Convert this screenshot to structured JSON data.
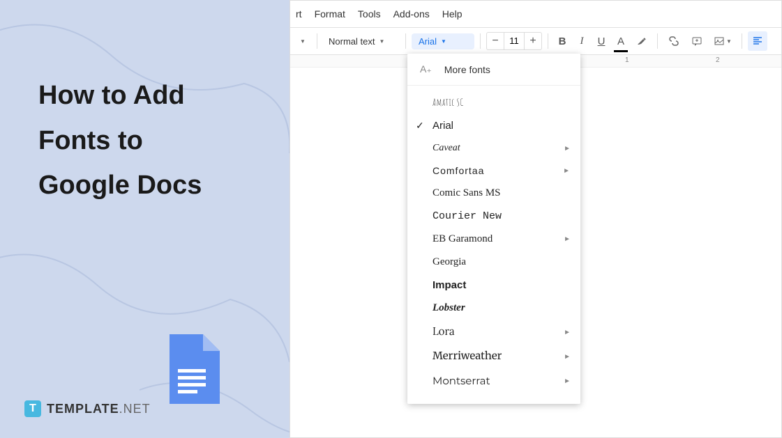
{
  "title_line1": "How to Add",
  "title_line2": "Fonts to",
  "title_line3": "Google Docs",
  "brand": {
    "logo_letter": "T",
    "name": "TEMPLATE",
    "suffix": ".NET"
  },
  "menubar": {
    "insert_truncated": "rt",
    "format": "Format",
    "tools": "Tools",
    "addons": "Add-ons",
    "help": "Help"
  },
  "toolbar": {
    "style_label": "Normal text",
    "font_label": "Arial",
    "font_size": "11",
    "bold": "B",
    "italic": "I",
    "underline": "U",
    "text_color": "A"
  },
  "ruler": {
    "mark1": "1",
    "mark2": "2"
  },
  "font_menu": {
    "more_fonts": "More fonts",
    "items": [
      {
        "label": "Amatic SC",
        "cls": "f-amatic",
        "has_sub": false,
        "checked": false
      },
      {
        "label": "Arial",
        "cls": "f-arial",
        "has_sub": false,
        "checked": true
      },
      {
        "label": "Caveat",
        "cls": "f-caveat",
        "has_sub": true,
        "checked": false
      },
      {
        "label": "Comfortaa",
        "cls": "f-comfortaa",
        "has_sub": true,
        "checked": false
      },
      {
        "label": "Comic Sans MS",
        "cls": "f-comic",
        "has_sub": false,
        "checked": false
      },
      {
        "label": "Courier New",
        "cls": "f-courier",
        "has_sub": false,
        "checked": false
      },
      {
        "label": "EB Garamond",
        "cls": "f-garamond",
        "has_sub": true,
        "checked": false
      },
      {
        "label": "Georgia",
        "cls": "f-georgia",
        "has_sub": false,
        "checked": false
      },
      {
        "label": "Impact",
        "cls": "f-impact",
        "has_sub": false,
        "checked": false
      },
      {
        "label": "Lobster",
        "cls": "f-lobster",
        "has_sub": false,
        "checked": false
      },
      {
        "label": "Lora",
        "cls": "f-lora",
        "has_sub": true,
        "checked": false
      },
      {
        "label": "Merriweather",
        "cls": "f-merri",
        "has_sub": true,
        "checked": false
      },
      {
        "label": "Montserrat",
        "cls": "f-mont",
        "has_sub": true,
        "checked": false
      }
    ]
  }
}
